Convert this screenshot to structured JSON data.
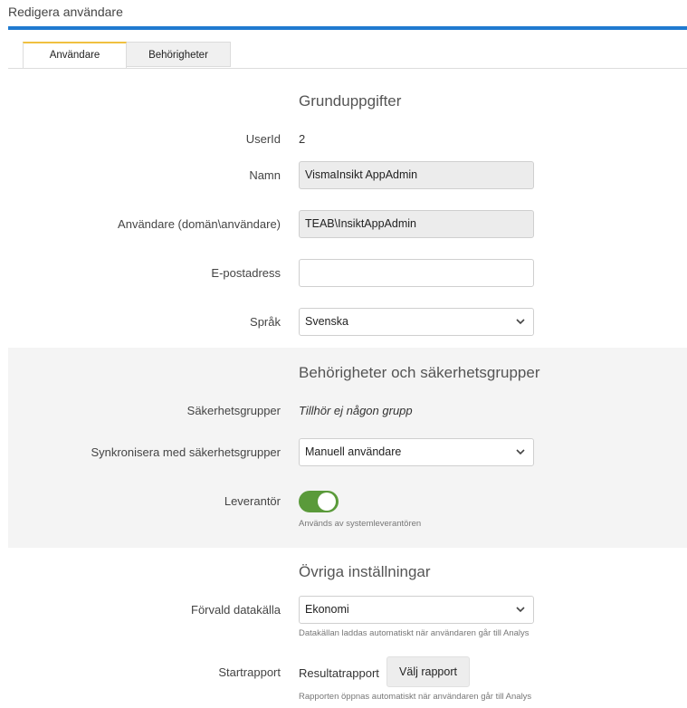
{
  "header": {
    "title": "Redigera användare"
  },
  "tabs": [
    {
      "label": "Användare",
      "active": true
    },
    {
      "label": "Behörigheter",
      "active": false
    }
  ],
  "basic": {
    "title": "Grunduppgifter",
    "userid_label": "UserId",
    "userid_value": "2",
    "name_label": "Namn",
    "name_value": "VismaInsikt AppAdmin",
    "user_label": "Användare (domän\\användare)",
    "user_value": "TEAB\\InsiktAppAdmin",
    "email_label": "E-postadress",
    "email_value": "",
    "language_label": "Språk",
    "language_value": "Svenska"
  },
  "security": {
    "title": "Behörigheter och säkerhetsgrupper",
    "groups_label": "Säkerhetsgrupper",
    "groups_value": "Tillhör ej någon grupp",
    "sync_label": "Synkronisera med säkerhetsgrupper",
    "sync_value": "Manuell användare",
    "supplier_label": "Leverantör",
    "supplier_on": true,
    "supplier_help": "Används av systemleverantören"
  },
  "other": {
    "title": "Övriga inställningar",
    "datasource_label": "Förvald datakälla",
    "datasource_value": "Ekonomi",
    "datasource_help": "Datakällan laddas automatiskt när användaren går till Analys",
    "startreport_label": "Startrapport",
    "startreport_value": "Resultatrapport",
    "choose_report_button": "Välj rapport",
    "startreport_help": "Rapporten öppnas automatiskt när användaren går till Analys"
  },
  "colors": {
    "accent_blue": "#1f7ad0",
    "tab_active_top": "#f0c040",
    "toggle_on": "#5a9a3a"
  },
  "icons": {
    "select_arrow": "chevron-down-icon"
  }
}
